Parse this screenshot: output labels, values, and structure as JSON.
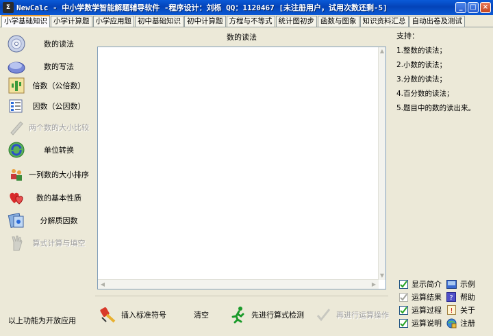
{
  "window": {
    "title": "NewCalc - 中小学数学智能解题辅导软件 -程序设计：刘栎  QQ：1120467 [未注册用户，试用次数还剩-5]"
  },
  "tabs": [
    {
      "label": "小学基础知识",
      "active": true
    },
    {
      "label": "小学计算题"
    },
    {
      "label": "小学应用题"
    },
    {
      "label": "初中基础知识"
    },
    {
      "label": "初中计算题"
    },
    {
      "label": "方程与不等式"
    },
    {
      "label": "统计图初步"
    },
    {
      "label": "函数与图象"
    },
    {
      "label": "知识资料汇总"
    },
    {
      "label": "自动出卷及测试"
    }
  ],
  "sidebar": {
    "items": [
      {
        "label": "数的读法",
        "icon": "cd-disc-icon"
      },
      {
        "label": "数的写法",
        "icon": "disk-icon"
      },
      {
        "label": "倍数（公倍数）",
        "icon": "cactus-icon"
      },
      {
        "label": "因数（公因数）",
        "icon": "list-icon"
      },
      {
        "label": "两个数的大小比较",
        "icon": "pen-icon",
        "disabled": true
      },
      {
        "label": "单位转换",
        "icon": "recycle-icon"
      },
      {
        "label": "一列数的大小排序",
        "icon": "people-icon"
      },
      {
        "label": "数的基本性质",
        "icon": "hearts-icon"
      },
      {
        "label": "分解质因数",
        "icon": "factor-icon"
      },
      {
        "label": "算式计算与填空",
        "icon": "hand-icon",
        "disabled": true
      }
    ],
    "footnote": "以上功能为开放应用"
  },
  "main": {
    "panel_title": "数的读法",
    "text_content": ""
  },
  "toolbar": {
    "insert_label": "插入标准符号",
    "clear_label": "清空",
    "check_label": "先进行算式检测",
    "run_label": "再进行运算操作"
  },
  "support": {
    "title": "支持：",
    "lines": [
      "1.整数的读法；",
      "2.小数的读法；",
      "3.分数的读法；",
      "4.百分数的读法；",
      "5.题目中的数的读出来。"
    ]
  },
  "options": {
    "show_intro": {
      "label": "显示简介",
      "checked": true
    },
    "calc_result": {
      "label": "运算结果",
      "checked": true,
      "disabled": true
    },
    "calc_process": {
      "label": "运算过程",
      "checked": true
    },
    "calc_explain": {
      "label": "运算说明",
      "checked": true
    }
  },
  "links": {
    "example": "示例",
    "help": "帮助",
    "about": "关于",
    "register": "注册"
  },
  "colors": {
    "titlebar": "#0a5ad8",
    "tab_accent": "#f0a030",
    "check_green": "#21a121"
  }
}
